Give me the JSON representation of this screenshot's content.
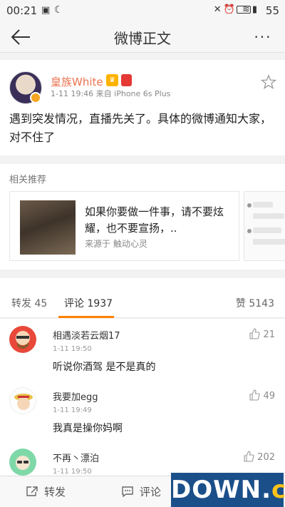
{
  "status": {
    "time": "00:21",
    "battery": "55"
  },
  "nav": {
    "title": "微博正文",
    "more": "···"
  },
  "post": {
    "username": "皇族White",
    "meta": "1-11 19:46  来自 iPhone 6s Plus",
    "text": "遇到突发情况，直播先关了。具体的微博通知大家，对不住了"
  },
  "related": {
    "title": "相关推荐",
    "card": {
      "text": "如果你要做一件事，请不要炫耀，也不要宣扬，..",
      "source": "来源于 触动心灵"
    }
  },
  "tabs": {
    "repost": "转发 45",
    "comment": "评论 1937",
    "like": "赞 5143"
  },
  "comments": [
    {
      "name": "相遇淡若云烟17",
      "time": "1-11 19:50",
      "text": "听说你酒驾 是不是真的",
      "likes": "21"
    },
    {
      "name": "我要加egg",
      "time": "1-11 19:49",
      "text": "我真是操你妈啊",
      "likes": "49"
    },
    {
      "name": "不再丶漂泊",
      "time": "1-11 19:50",
      "text": "",
      "likes": "202"
    }
  ],
  "bottom": {
    "repost": "转发",
    "comment": "评论"
  },
  "watermark": {
    "main": "DOWN",
    "dot": ".",
    "suffix": "cc"
  }
}
